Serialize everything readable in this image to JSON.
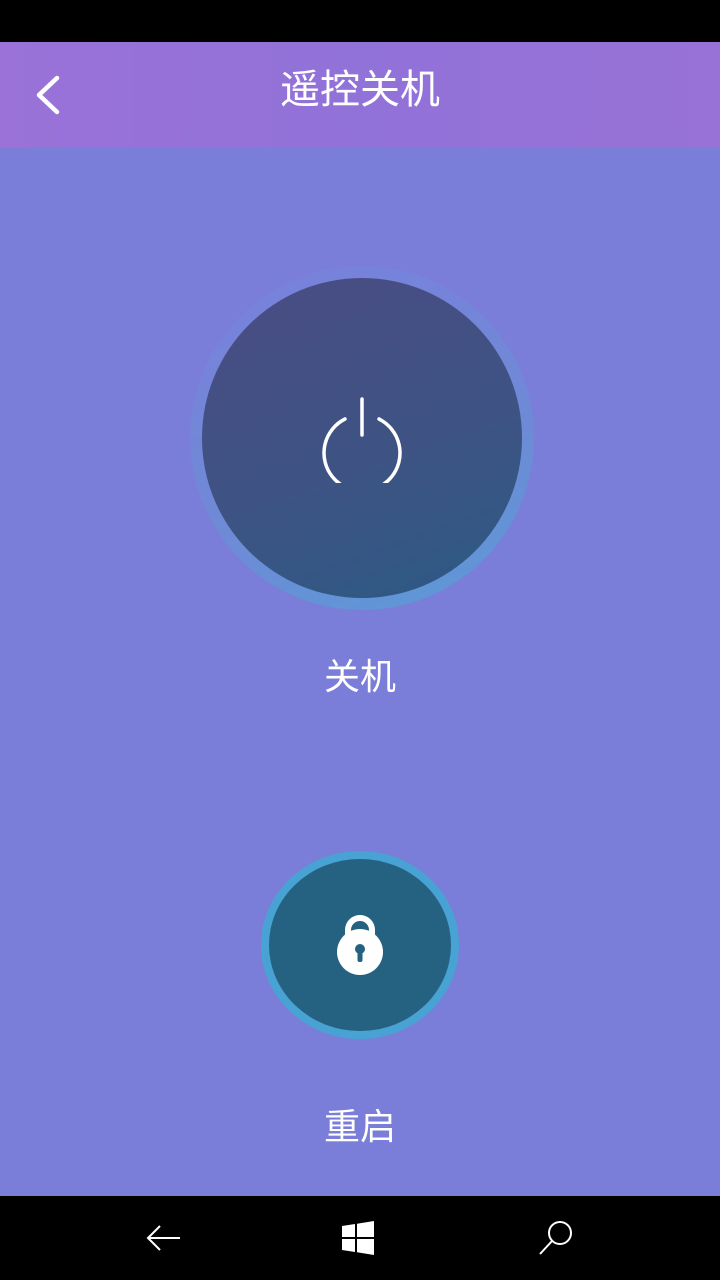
{
  "header": {
    "title": "遥控关机",
    "back_icon": "chevron-left-icon"
  },
  "main": {
    "shutdown": {
      "label": "关机",
      "icon": "power-icon"
    },
    "restart": {
      "label": "重启",
      "icon": "lock-icon"
    }
  },
  "nav_bar": {
    "items": [
      {
        "icon": "back-arrow-icon"
      },
      {
        "icon": "windows-icon"
      },
      {
        "icon": "search-icon"
      }
    ]
  },
  "colors": {
    "header_bg": "#9172d8",
    "main_bg": "#7a7ed8",
    "power_core": "#3e5384",
    "restart_ring": "#48a2d4",
    "restart_core": "#256281"
  }
}
